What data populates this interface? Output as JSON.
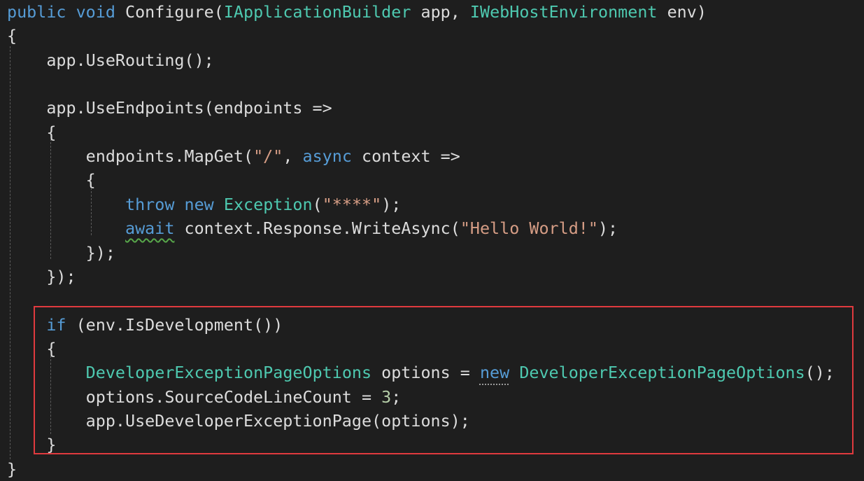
{
  "editor": {
    "colors": {
      "background": "#1e1e1e",
      "keyword": "#569cd6",
      "type": "#4ec9b0",
      "string": "#d69d85",
      "number": "#b5cea8",
      "plain": "#dcdcdc",
      "highlight_box": "#e03a3e"
    },
    "lines": [
      [
        [
          "public",
          "kw"
        ],
        [
          " ",
          "plain"
        ],
        [
          "void",
          "kw"
        ],
        [
          " Configure(",
          "plain"
        ],
        [
          "IApplicationBuilder",
          "type"
        ],
        [
          " app, ",
          "plain"
        ],
        [
          "IWebHostEnvironment",
          "type"
        ],
        [
          " env)",
          "plain"
        ]
      ],
      [
        [
          "{",
          "plain"
        ]
      ],
      [
        [
          "    app.UseRouting();",
          "plain"
        ]
      ],
      [
        [
          "",
          "plain"
        ]
      ],
      [
        [
          "    app.UseEndpoints(endpoints =>",
          "plain"
        ]
      ],
      [
        [
          "    {",
          "plain"
        ]
      ],
      [
        [
          "        endpoints.MapGet(",
          "plain"
        ],
        [
          "\"/\"",
          "str"
        ],
        [
          ", ",
          "plain"
        ],
        [
          "async",
          "kw"
        ],
        [
          " context =>",
          "plain"
        ]
      ],
      [
        [
          "        {",
          "plain"
        ]
      ],
      [
        [
          "            ",
          "plain"
        ],
        [
          "throw",
          "kw"
        ],
        [
          " ",
          "plain"
        ],
        [
          "new",
          "kw"
        ],
        [
          " ",
          "plain"
        ],
        [
          "Exception",
          "type"
        ],
        [
          "(",
          "plain"
        ],
        [
          "\"****\"",
          "str"
        ],
        [
          ");",
          "plain"
        ]
      ],
      [
        [
          "            ",
          "plain"
        ],
        [
          "await",
          "kw",
          "squiggle"
        ],
        [
          " context.Response.WriteAsync(",
          "plain"
        ],
        [
          "\"Hello World!\"",
          "str"
        ],
        [
          ");",
          "plain"
        ]
      ],
      [
        [
          "        });",
          "plain"
        ]
      ],
      [
        [
          "    });",
          "plain"
        ]
      ],
      [
        [
          "",
          "plain"
        ]
      ],
      [
        [
          "    ",
          "plain"
        ],
        [
          "if",
          "kw"
        ],
        [
          " (env.IsDevelopment())",
          "plain"
        ]
      ],
      [
        [
          "    {",
          "plain"
        ]
      ],
      [
        [
          "        ",
          "plain"
        ],
        [
          "DeveloperExceptionPageOptions",
          "type"
        ],
        [
          " options = ",
          "plain"
        ],
        [
          "new",
          "kw",
          "dots"
        ],
        [
          " ",
          "plain"
        ],
        [
          "DeveloperExceptionPageOptions",
          "type"
        ],
        [
          "();",
          "plain"
        ]
      ],
      [
        [
          "        options.SourceCodeLineCount = ",
          "plain"
        ],
        [
          "3",
          "num"
        ],
        [
          ";",
          "plain"
        ]
      ],
      [
        [
          "        app.UseDeveloperExceptionPage(options);",
          "plain"
        ]
      ],
      [
        [
          "    }",
          "plain"
        ]
      ],
      [
        [
          "}",
          "plain"
        ]
      ]
    ]
  }
}
